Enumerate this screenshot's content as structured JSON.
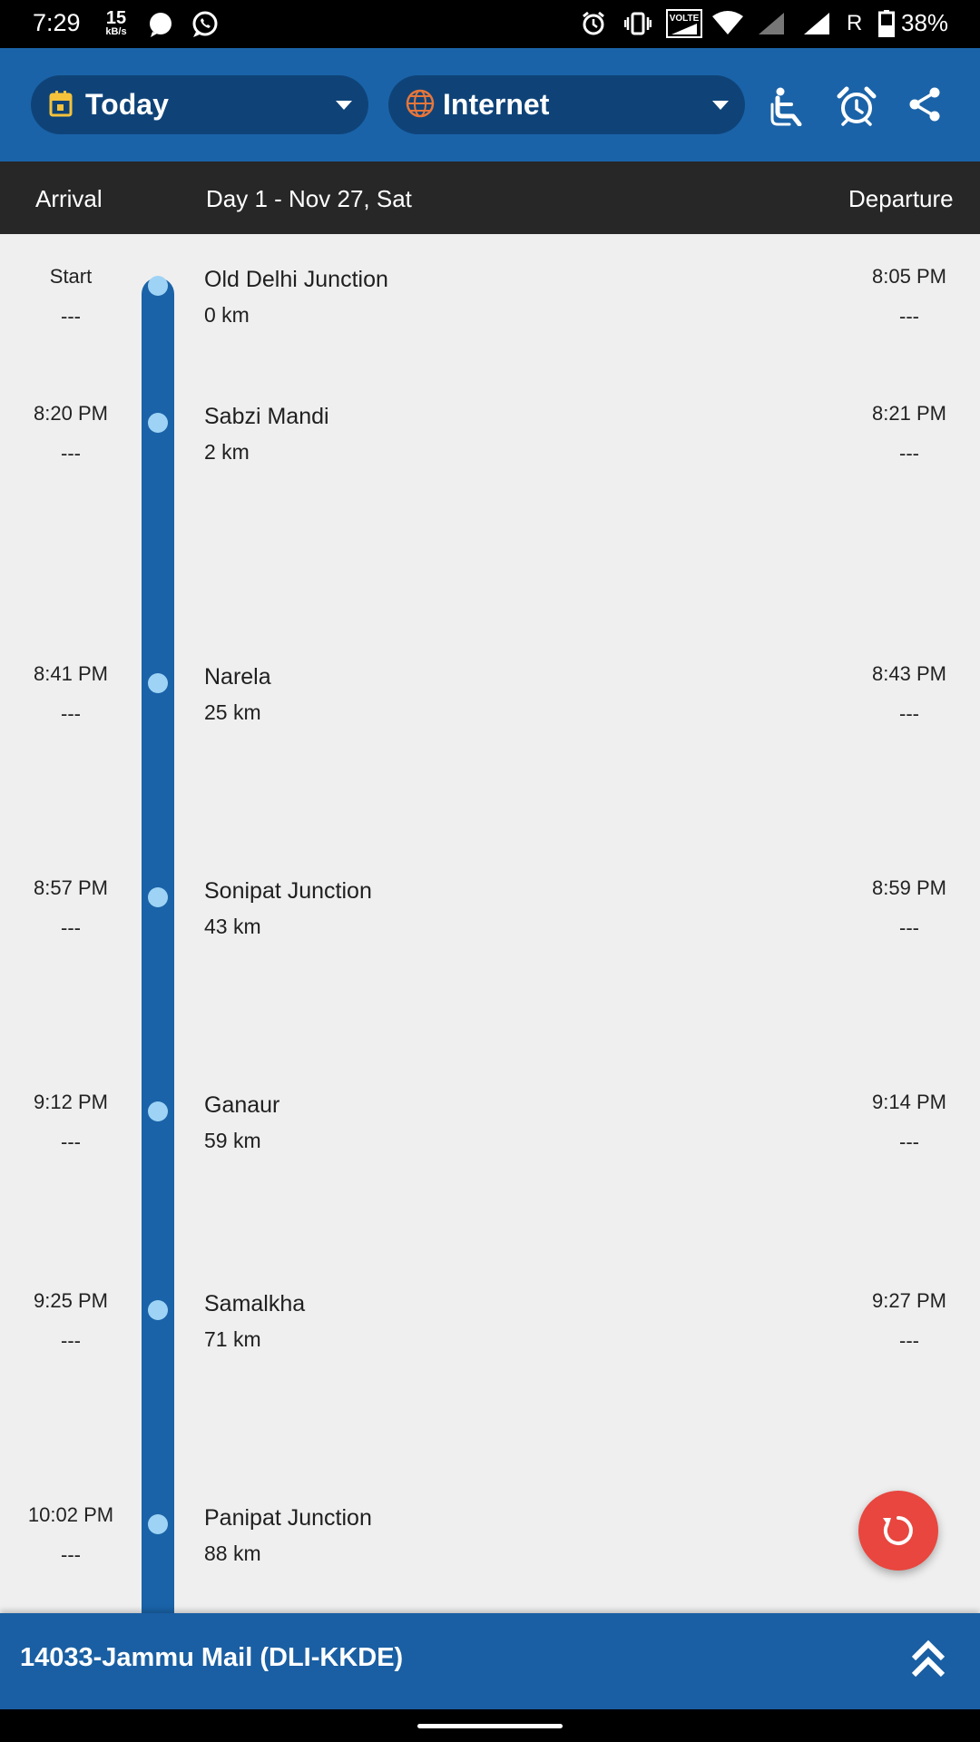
{
  "status_bar": {
    "time": "7:29",
    "net_speed_value": "15",
    "net_speed_unit": "kB/s",
    "carrier_indicator": "R",
    "battery": "38%"
  },
  "toolbar": {
    "date_selector": {
      "label": "Today",
      "icon": "calendar-icon"
    },
    "source_selector": {
      "label": "Internet",
      "icon": "globe-icon"
    },
    "actions": [
      "accessible-seat-icon",
      "alarm-clock-icon",
      "share-icon"
    ],
    "accent_color": "#1a63a8"
  },
  "header": {
    "arrival_label": "Arrival",
    "day_label": "Day 1 - Nov 27, Sat",
    "departure_label": "Departure"
  },
  "stops": [
    {
      "arrival": "Start",
      "arrival_delay": "---",
      "name": "Old Delhi Junction",
      "distance": "0 km",
      "departure": "8:05 PM",
      "departure_delay": "---"
    },
    {
      "arrival": "8:20 PM",
      "arrival_delay": "---",
      "name": "Sabzi Mandi",
      "distance": "2 km",
      "departure": "8:21 PM",
      "departure_delay": "---"
    },
    {
      "arrival": "8:41 PM",
      "arrival_delay": "---",
      "name": "Narela",
      "distance": "25 km",
      "departure": "8:43 PM",
      "departure_delay": "---"
    },
    {
      "arrival": "8:57 PM",
      "arrival_delay": "---",
      "name": "Sonipat Junction",
      "distance": "43 km",
      "departure": "8:59 PM",
      "departure_delay": "---"
    },
    {
      "arrival": "9:12 PM",
      "arrival_delay": "---",
      "name": "Ganaur",
      "distance": "59 km",
      "departure": "9:14 PM",
      "departure_delay": "---"
    },
    {
      "arrival": "9:25 PM",
      "arrival_delay": "---",
      "name": "Samalkha",
      "distance": "71 km",
      "departure": "9:27 PM",
      "departure_delay": "---"
    },
    {
      "arrival": "10:02 PM",
      "arrival_delay": "---",
      "name": "Panipat Junction",
      "distance": "88 km",
      "departure": "",
      "departure_delay": ""
    }
  ],
  "fab": {
    "icon": "refresh-icon",
    "color": "#e8463e"
  },
  "bottom_bar": {
    "train_title": "14033-Jammu Mail (DLI-KKDE)",
    "expand_icon": "double-chevron-up-icon"
  }
}
